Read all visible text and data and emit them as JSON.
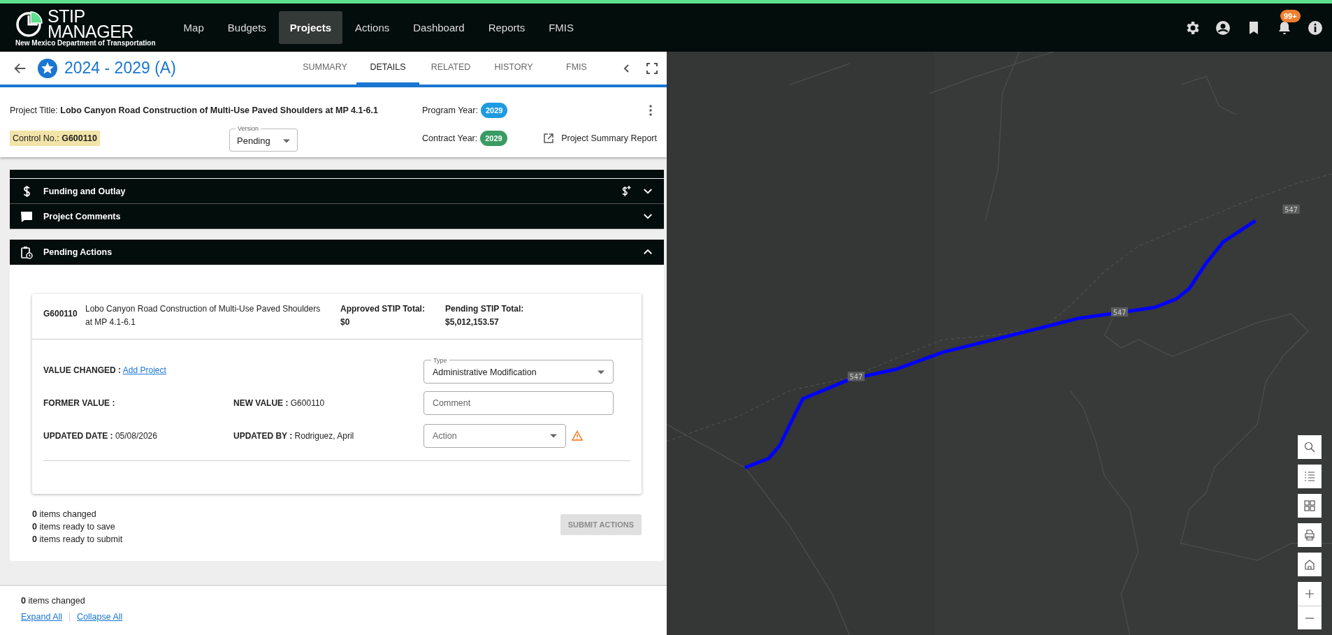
{
  "header": {
    "logo": {
      "line_1": "STIP",
      "line_2": "MANAGER",
      "subtitle": "New Mexico Department of Transportation"
    },
    "nav": [
      {
        "label": "Map",
        "selected": false
      },
      {
        "label": "Budgets",
        "selected": false
      },
      {
        "label": "Projects",
        "selected": true
      },
      {
        "label": "Actions",
        "selected": false
      },
      {
        "label": "Dashboard",
        "selected": false
      },
      {
        "label": "Reports",
        "selected": false
      },
      {
        "label": "FMIS",
        "selected": false
      }
    ],
    "notification_badge": "99+"
  },
  "project_bar": {
    "title": "2024 - 2029 (A)",
    "tabs": [
      {
        "label": "SUMMARY",
        "selected": false
      },
      {
        "label": "DETAILS",
        "selected": true
      },
      {
        "label": "RELATED",
        "selected": false
      },
      {
        "label": "HISTORY",
        "selected": false
      },
      {
        "label": "FMIS",
        "selected": false
      }
    ]
  },
  "project_info": {
    "title_label": "Project Title:",
    "title": "Lobo Canyon Road Construction of Multi-Use Paved Shoulders at MP 4.1-6.1",
    "control_label": "Control No.:",
    "control_no": "G600110",
    "version": {
      "label": "Version",
      "value": "Pending"
    },
    "years": [
      {
        "label": "Program Year:",
        "value": "2029",
        "color": "#1e9be0"
      },
      {
        "label": "Contract Year:",
        "value": "2029",
        "color": "#3a9b63"
      }
    ],
    "report_link": "Project Summary Report"
  },
  "sections": [
    {
      "kind": "funding",
      "title": "Funding and Outlay",
      "expanded": false
    },
    {
      "kind": "comments",
      "title": "Project Comments",
      "expanded": false
    },
    {
      "kind": "pending",
      "title": "Pending Actions",
      "expanded": true
    }
  ],
  "pending_card": {
    "control_no": "G600110",
    "description": "Lobo Canyon Road Construction of Multi-Use Paved Shoulders at MP 4.1-6.1",
    "totals": [
      {
        "label": "Approved STIP Total:",
        "value": "$0"
      },
      {
        "label": "Pending STIP Total:",
        "value": "$5,012,153.57"
      }
    ],
    "value_changed": {
      "label": "VALUE CHANGED :",
      "link": "Add Project"
    },
    "fields": [
      {
        "label": "FORMER VALUE :"
      },
      {
        "label": "NEW VALUE :",
        "value": "G600110"
      },
      {
        "label": "UPDATED DATE :",
        "value": "05/08/2026"
      },
      {
        "label": "UPDATED BY :",
        "value": "Rodriguez, April"
      }
    ],
    "type_select": {
      "label": "Type",
      "value": "Administrative Modification"
    },
    "comment": {
      "placeholder": "Comment"
    },
    "action_select": {
      "placeholder": "Action"
    }
  },
  "summary": {
    "counts": [
      {
        "count": "0",
        "text": "items changed"
      },
      {
        "count": "0",
        "text": "items ready to save"
      },
      {
        "count": "0",
        "text": "items ready to submit"
      }
    ],
    "submit_button": {
      "label": "SUBMIT ACTIONS",
      "disabled": true
    }
  },
  "footer": {
    "count": "0",
    "text": "items changed",
    "links": [
      "Expand All",
      "Collapse All"
    ]
  },
  "map": {
    "route_labels": [
      "547",
      "547",
      "547"
    ]
  }
}
